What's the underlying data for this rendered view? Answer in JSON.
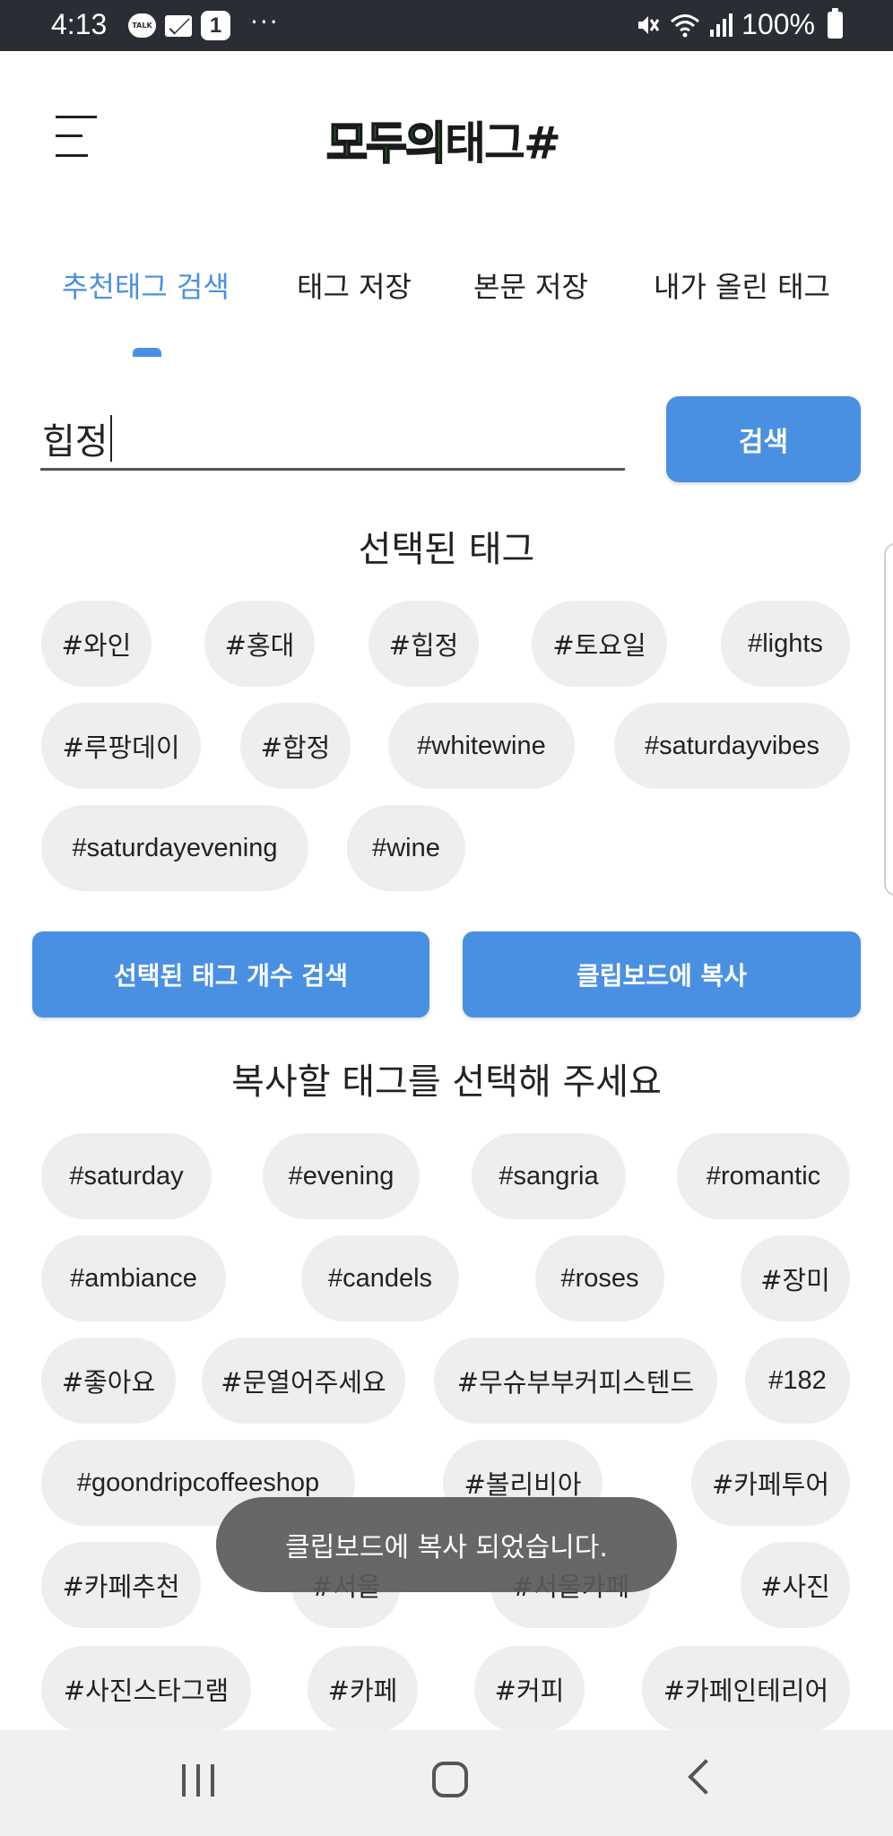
{
  "status_bar": {
    "time": "4:13",
    "talk_label": "TALK",
    "notification_count": "1",
    "more": "···",
    "battery": "100%"
  },
  "header": {
    "logo_part1": "모두의",
    "logo_part2": "태그#"
  },
  "tabs": [
    {
      "label": "추천태그 검색",
      "active": true
    },
    {
      "label": "태그 저장",
      "active": false
    },
    {
      "label": "본문 저장",
      "active": false
    },
    {
      "label": "내가 올린 태그",
      "active": false
    }
  ],
  "search": {
    "value": "힙정",
    "button_label": "검색"
  },
  "selected_section": {
    "title": "선택된 태그",
    "tags": [
      "#와인",
      "#홍대",
      "#힙정",
      "#토요일",
      "#lights",
      "#루팡데이",
      "#합정",
      "#whitewine",
      "#saturdayvibes",
      "#saturdayevening",
      "#wine"
    ]
  },
  "actions": {
    "count_search_label": "선택된 태그 개수 검색",
    "copy_label": "클립보드에 복사"
  },
  "copy_section": {
    "title": "복사할 태그를 선택해 주세요",
    "tags": [
      "#saturday",
      "#evening",
      "#sangria",
      "#romantic",
      "#ambiance",
      "#candels",
      "#roses",
      "#장미",
      "#좋아요",
      "#문열어주세요",
      "#무슈부부커피스텐드",
      "#182",
      "#goondripcoffeeshop",
      "#볼리비아",
      "#카페투어",
      "#카페추천",
      "#서울",
      "#서울카페",
      "#사진",
      "#사진스타그램",
      "#카페",
      "#커피",
      "#카페인테리어"
    ]
  },
  "toast": {
    "message": "클립보드에 복사 되었습니다."
  },
  "colors": {
    "accent": "#4a90e2",
    "chip_bg": "#eeeeee",
    "status_bar_bg": "#2b2d35",
    "logo_green": "#3ea83b"
  }
}
